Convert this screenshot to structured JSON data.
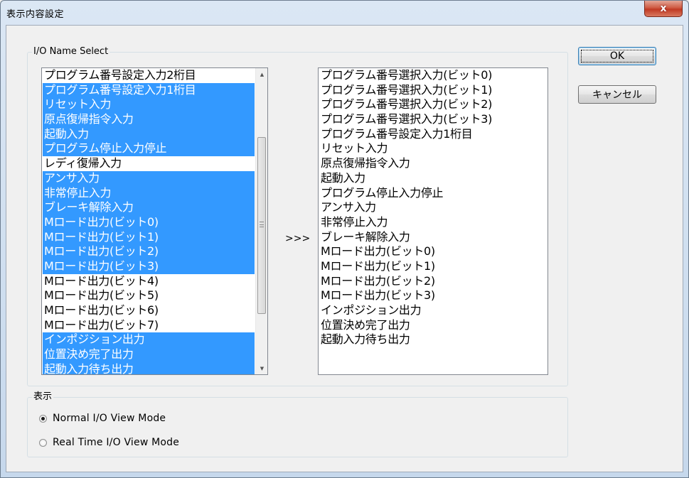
{
  "window": {
    "title": "表示内容設定",
    "close_glyph": "x"
  },
  "io_group": {
    "label": "I/O Name Select"
  },
  "mode_group": {
    "label": "表示"
  },
  "buttons": {
    "ok": "OK",
    "cancel": "キャンセル"
  },
  "transfer_arrow": ">>>",
  "left_list": {
    "items": [
      {
        "label": "プログラム番号設定入力2桁目",
        "selected": false
      },
      {
        "label": "プログラム番号設定入力1桁目",
        "selected": true
      },
      {
        "label": "リセット入力",
        "selected": true
      },
      {
        "label": "原点復帰指令入力",
        "selected": true
      },
      {
        "label": "起動入力",
        "selected": true
      },
      {
        "label": "プログラム停止入力停止",
        "selected": true
      },
      {
        "label": "レディ復帰入力",
        "selected": false
      },
      {
        "label": "アンサ入力",
        "selected": true
      },
      {
        "label": "非常停止入力",
        "selected": true
      },
      {
        "label": "ブレーキ解除入力",
        "selected": true
      },
      {
        "label": "Mロード出力(ビット0)",
        "selected": true
      },
      {
        "label": "Mロード出力(ビット1)",
        "selected": true
      },
      {
        "label": "Mロード出力(ビット2)",
        "selected": true
      },
      {
        "label": "Mロード出力(ビット3)",
        "selected": true
      },
      {
        "label": "Mロード出力(ビット4)",
        "selected": false
      },
      {
        "label": "Mロード出力(ビット5)",
        "selected": false
      },
      {
        "label": "Mロード出力(ビット6)",
        "selected": false
      },
      {
        "label": "Mロード出力(ビット7)",
        "selected": false
      },
      {
        "label": "インポジション出力",
        "selected": true
      },
      {
        "label": "位置決め完了出力",
        "selected": true
      },
      {
        "label": "起動入力待ち出力",
        "selected": true
      }
    ]
  },
  "right_list": {
    "items": [
      "プログラム番号選択入力(ビット0)",
      "プログラム番号選択入力(ビット1)",
      "プログラム番号選択入力(ビット2)",
      "プログラム番号選択入力(ビット3)",
      "プログラム番号設定入力1桁目",
      "リセット入力",
      "原点復帰指令入力",
      "起動入力",
      "プログラム停止入力停止",
      "アンサ入力",
      "非常停止入力",
      "ブレーキ解除入力",
      "Mロード出力(ビット0)",
      "Mロード出力(ビット1)",
      "Mロード出力(ビット2)",
      "Mロード出力(ビット3)",
      "インポジション出力",
      "位置決め完了出力",
      "起動入力待ち出力"
    ]
  },
  "view_mode": {
    "options": [
      {
        "label": "Normal I/O View Mode",
        "checked": true
      },
      {
        "label": "Real Time I/O View Mode",
        "checked": false
      }
    ]
  }
}
